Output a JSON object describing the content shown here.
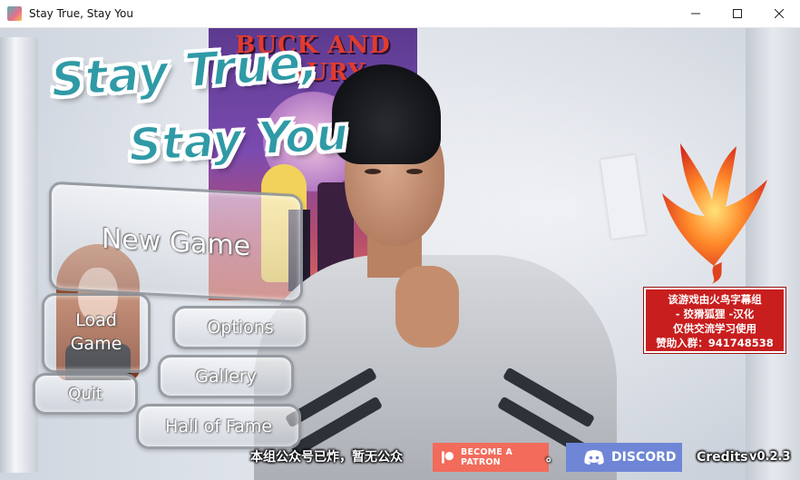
{
  "window": {
    "title": "Stay True, Stay You",
    "icon": "app-logo-icon"
  },
  "logo": {
    "line1": "Stay True,",
    "line2": "Stay You",
    "color": "#2f9aa6"
  },
  "poster": {
    "title": "BUCK AND MAURY"
  },
  "menu": {
    "new_game": "New Game",
    "load_line1": "Load",
    "load_line2": "Game",
    "options": "Options",
    "gallery": "Gallery",
    "quit": "Quit",
    "hall_of_fame": "Hall of Fame"
  },
  "notice": {
    "lines": [
      "该游戏由火鸟字幕组",
      "- 狡猾狐狸 -汉化",
      "仅供交流学习使用",
      "赞助入群：941748538"
    ],
    "bg_color": "#c81e1e"
  },
  "footer": {
    "subtitle": "本组公众号已炸，暂无公众",
    "subtitle_tail": "。",
    "patron_label": "BECOME A PATRON",
    "patron_color": "#f26b5b",
    "discord_label": "DISCORD",
    "discord_color": "#6f86d6",
    "credits_label": "Credits",
    "version": "v0.2.3"
  }
}
